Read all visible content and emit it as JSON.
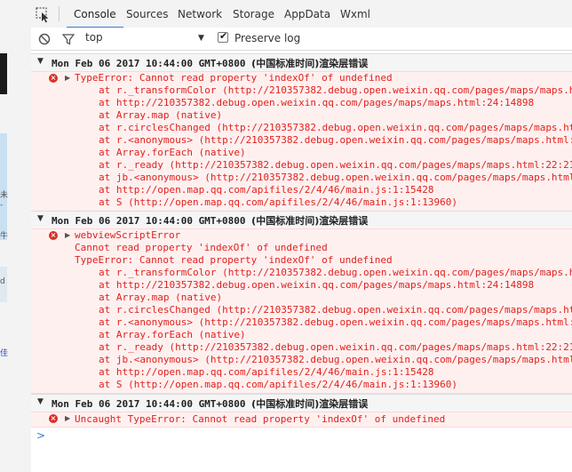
{
  "tabs": [
    {
      "label": "Console",
      "active": true
    },
    {
      "label": "Sources",
      "active": false
    },
    {
      "label": "Network",
      "active": false
    },
    {
      "label": "Storage",
      "active": false
    },
    {
      "label": "AppData",
      "active": false
    },
    {
      "label": "Wxml",
      "active": false
    }
  ],
  "toolbar": {
    "context_value": "top",
    "preserve_log_label": "Preserve log",
    "preserve_log_checked": true
  },
  "left_strip": {
    "chars": [
      "未",
      "-",
      "牛",
      "d",
      "佳"
    ]
  },
  "groups": [
    {
      "timestamp": "Mon Feb 06 2017 10:44:00 GMT+0800",
      "timestamp_suffix": "(中国标准时间)渲染层错误",
      "lines": [
        "TypeError: Cannot read property 'indexOf' of undefined",
        "at r._transformColor (http://210357382.debug.open.weixin.qq.com/pages/maps/maps.h",
        "at http://210357382.debug.open.weixin.qq.com/pages/maps/maps.html:24:14898",
        "at Array.map (native)",
        "at r.circlesChanged (http://210357382.debug.open.weixin.qq.com/pages/maps/maps.ht",
        "at r.<anonymous> (http://210357382.debug.open.weixin.qq.com/pages/maps/maps.html:",
        "at Array.forEach (native)",
        "at r._ready (http://210357382.debug.open.weixin.qq.com/pages/maps/maps.html:22:21",
        "at jb.<anonymous> (http://210357382.debug.open.weixin.qq.com/pages/maps/maps.html",
        "at http://open.map.qq.com/apifiles/2/4/46/main.js:1:15428",
        "at S (http://open.map.qq.com/apifiles/2/4/46/main.js:1:13960)"
      ]
    },
    {
      "timestamp": "Mon Feb 06 2017 10:44:00 GMT+0800",
      "timestamp_suffix": "(中国标准时间)渲染层错误",
      "lines": [
        "webviewScriptError",
        "Cannot read property 'indexOf' of undefined",
        "TypeError: Cannot read property 'indexOf' of undefined",
        "at r._transformColor (http://210357382.debug.open.weixin.qq.com/pages/maps/maps.h",
        "at http://210357382.debug.open.weixin.qq.com/pages/maps/maps.html:24:14898",
        "at Array.map (native)",
        "at r.circlesChanged (http://210357382.debug.open.weixin.qq.com/pages/maps/maps.ht",
        "at r.<anonymous> (http://210357382.debug.open.weixin.qq.com/pages/maps/maps.html:",
        "at Array.forEach (native)",
        "at r._ready (http://210357382.debug.open.weixin.qq.com/pages/maps/maps.html:22:21",
        "at jb.<anonymous> (http://210357382.debug.open.weixin.qq.com/pages/maps/maps.html",
        "at http://open.map.qq.com/apifiles/2/4/46/main.js:1:15428",
        "at S (http://open.map.qq.com/apifiles/2/4/46/main.js:1:13960)"
      ]
    },
    {
      "timestamp": "Mon Feb 06 2017 10:44:00 GMT+0800",
      "timestamp_suffix": "(中国标准时间)渲染层错误",
      "lines": [
        "Uncaught TypeError: Cannot read property 'indexOf' of undefined"
      ]
    }
  ],
  "prompt": ">",
  "colors": {
    "error_text": "#e0221c",
    "error_bg": "#fff0f0",
    "accent": "#3879d9"
  }
}
